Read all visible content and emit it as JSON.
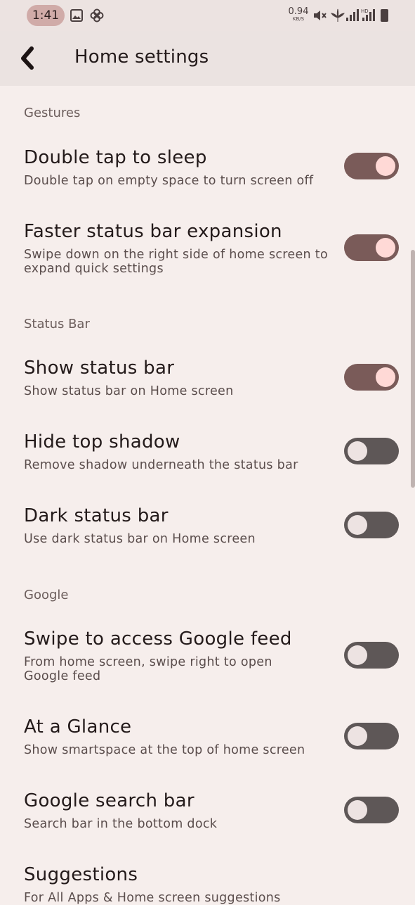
{
  "status_bar": {
    "time": "1:41",
    "net_speed_value": "0.94",
    "net_speed_unit": "KB/S",
    "icons": [
      "gallery-icon",
      "pinwheel-icon",
      "mute-icon",
      "leaf-icon",
      "signal-icon",
      "hd-signal-icon",
      "battery-icon"
    ]
  },
  "app_bar": {
    "title": "Home settings",
    "back_icon": "back-chevron-icon"
  },
  "sections": [
    {
      "header": "Gestures",
      "items": [
        {
          "title": "Double tap to sleep",
          "summary": "Double tap on empty space to turn screen off",
          "enabled": true
        },
        {
          "title": "Faster status bar expansion",
          "summary": "Swipe down on the right side of home screen to expand quick settings",
          "enabled": true
        }
      ]
    },
    {
      "header": "Status Bar",
      "items": [
        {
          "title": "Show status bar",
          "summary": "Show status bar on Home screen",
          "enabled": true
        },
        {
          "title": "Hide top shadow",
          "summary": "Remove shadow underneath the status bar",
          "enabled": false
        },
        {
          "title": "Dark status bar",
          "summary": "Use dark status bar on Home screen",
          "enabled": false
        }
      ]
    },
    {
      "header": "Google",
      "items": [
        {
          "title": "Swipe to access Google feed",
          "summary": "From home screen, swipe right to open Google feed",
          "enabled": false
        },
        {
          "title": "At a Glance",
          "summary": "Show smartspace at the top of home screen",
          "enabled": false
        },
        {
          "title": "Google search bar",
          "summary": "Search bar in the bottom dock",
          "enabled": false
        },
        {
          "title": "Suggestions",
          "summary": "For All Apps & Home screen suggestions"
        }
      ]
    }
  ],
  "colors": {
    "background": "#f6eeec",
    "app_bar": "#ebe3e1",
    "toggle_on_track": "#7a5b59",
    "toggle_on_knob": "#ffd9d6",
    "toggle_off_track": "#5e5757",
    "toggle_off_knob": "#ede3e2"
  }
}
